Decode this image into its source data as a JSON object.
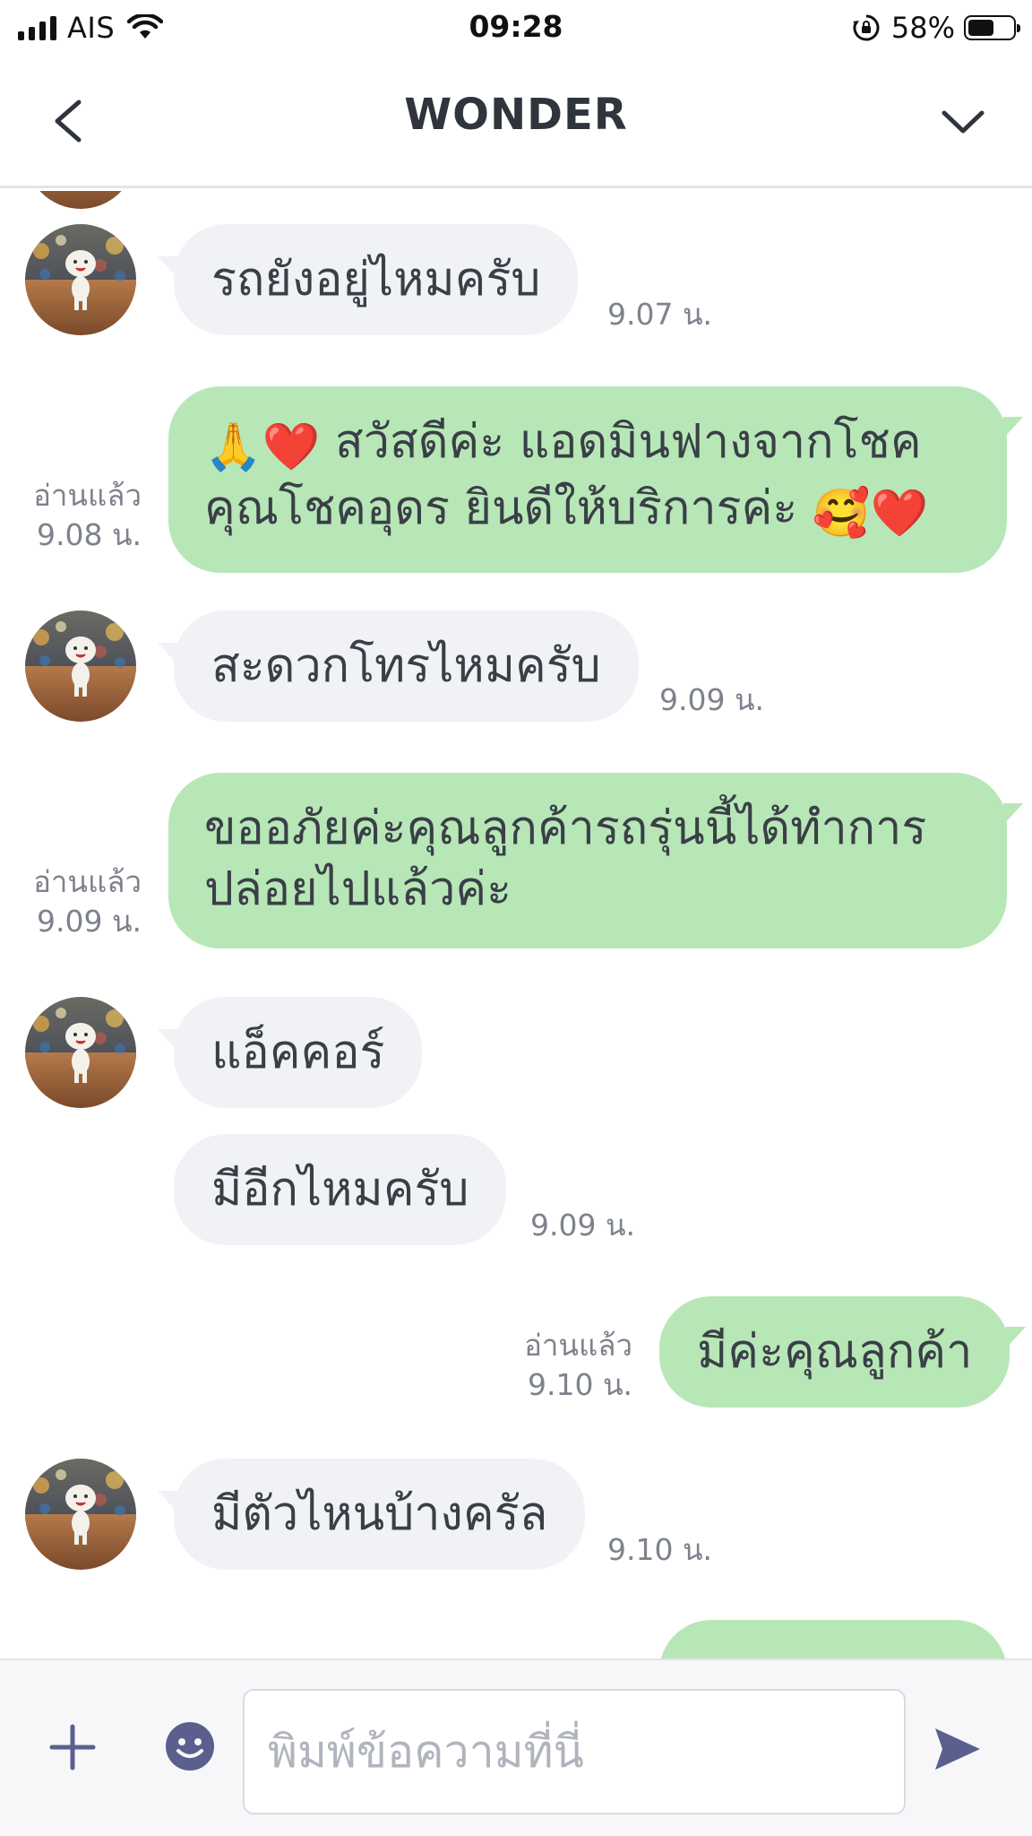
{
  "status_bar": {
    "carrier": "AIS",
    "time": "09:28",
    "battery": "58%",
    "battery_level": 0.58
  },
  "header": {
    "title": "WONDER",
    "back_icon": "chevron-left-icon",
    "menu_icon": "chevron-down-icon"
  },
  "messages": [
    {
      "side": "in",
      "text": "รถยังอยู่ไหมครับ",
      "time": "9.07 น."
    },
    {
      "side": "out",
      "line1_text": "สวัสดีค่ะ แอดมินฟางจากโชค",
      "line2_text": "คุณโชคอุดร ยินดีให้บริการค่ะ",
      "emojis": [
        "🙏",
        "❤️",
        "🥰",
        "❤️"
      ],
      "read": "อ่านแล้ว",
      "time": "9.08 น."
    },
    {
      "side": "in",
      "text": "สะดวกโทรไหมครับ",
      "time": "9.09 น."
    },
    {
      "side": "out",
      "line1_text": "ขออภัยค่ะคุณลูกค้ารถรุ่นนี้ได้ทำการ",
      "line2_text": "ปล่อยไปแล้วค่ะ",
      "read": "อ่านแล้ว",
      "time": "9.09 น."
    },
    {
      "side": "in",
      "text": "แอ็คคอร์"
    },
    {
      "side": "in",
      "text": "มีอีกไหมครับ",
      "time": "9.09 น."
    },
    {
      "side": "out",
      "text": "มีค่ะคุณลูกค้า",
      "read": "อ่านแล้ว",
      "time": "9.10 น."
    },
    {
      "side": "in",
      "text": "มีตัวไหนบ้างครัล",
      "time": "9.10 น."
    }
  ],
  "input": {
    "placeholder": "พิมพ์ข้อความที่นี่",
    "value": ""
  },
  "colors": {
    "outgoing_bubble": "#b7e7b6",
    "incoming_bubble": "#f1f2f5",
    "icon_accent": "#5b5f8e"
  }
}
